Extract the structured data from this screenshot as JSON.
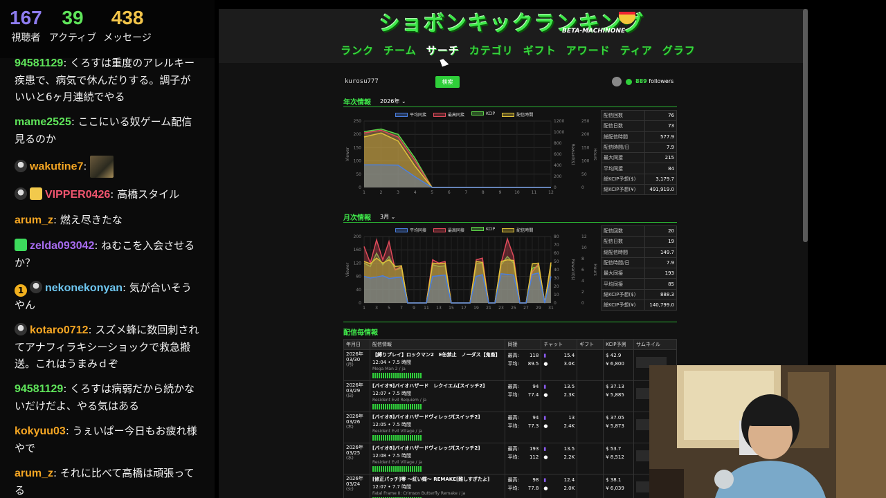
{
  "stats": [
    {
      "value": "167",
      "label": "視聴者",
      "color": "#8e7cf0"
    },
    {
      "value": "39",
      "label": "アクティブ",
      "color": "#5fe55a"
    },
    {
      "value": "438",
      "label": "メッセージ",
      "color": "#f3c54a"
    }
  ],
  "chat": [
    {
      "user": "94581129",
      "color": "#5fe55a",
      "text": "くろすは重度のアレルキー疾患で、病気で休んだりする。調子がいいと6ヶ月連続でやる",
      "badges": []
    },
    {
      "user": "mame2525",
      "color": "#5fe55a",
      "text": "ここにいる奴ゲーム配信見るのか",
      "badges": []
    },
    {
      "user": "wakutine7",
      "color": "#f5a623",
      "text": "",
      "badges": [
        "skull"
      ],
      "emote": true
    },
    {
      "user": "VIPPER0426",
      "color": "#f0556f",
      "text": "高橋スタイル",
      "badges": [
        "skull",
        "gift"
      ]
    },
    {
      "user": "arum_z",
      "color": "#f5a623",
      "text": "燃え尽きたな",
      "badges": []
    },
    {
      "user": "zelda093042",
      "color": "#a76cf0",
      "text": "ねむこを入会させるか？",
      "badges": [
        "gift2"
      ]
    },
    {
      "user": "nekonekonyan",
      "color": "#6ec6f0",
      "text": "気が合いそうやん",
      "badges": [
        "one",
        "skull"
      ]
    },
    {
      "user": "kotaro0712",
      "color": "#f5a623",
      "text": "スズメ蜂に数回刺されてアナフィラキシーショックで救急搬送。これはうまみｄぞ",
      "badges": [
        "skull"
      ]
    },
    {
      "user": "94581129",
      "color": "#5fe55a",
      "text": "くろすは病弱だから続かないだけだよ、やる気はある",
      "badges": []
    },
    {
      "user": "kokyuu03",
      "color": "#f5a623",
      "text": "うぇいぱー今日もお疲れ様やで",
      "badges": []
    },
    {
      "user": "arum_z",
      "color": "#f5a623",
      "text": "それに比べて高橋は頑張ってる",
      "badges": []
    }
  ],
  "site": {
    "logo": "ショボンキックランキング",
    "logo_sub": "BETA-MACHINONE",
    "nav": [
      "ランク",
      "チーム",
      "サーチ",
      "カテゴリ",
      "ギフト",
      "アワード",
      "ティア",
      "グラフ"
    ],
    "nav_active": 2,
    "search_value": "kurosu777",
    "search_button": "検索",
    "followers_count": "889",
    "followers_label": "followers",
    "yearly": {
      "title": "年次情報",
      "select": "2026年",
      "legend": [
        "平均同接",
        "最高同接",
        "KCIP",
        "配信時間"
      ],
      "y_left_label": "Viewer",
      "y_right1_label": "Reward($)",
      "y_right2_label": "Hours",
      "stats": [
        [
          "配信回数",
          "76"
        ],
        [
          "配信日数",
          "73"
        ],
        [
          "総配信時間",
          "577.9"
        ],
        [
          "配信時間/日",
          "7.9"
        ],
        [
          "最大同接",
          "215"
        ],
        [
          "平均同接",
          "84"
        ],
        [
          "総KCIP予想($)",
          "3,179.7"
        ],
        [
          "総KCIP予想(¥)",
          "491,919.0"
        ]
      ]
    },
    "monthly": {
      "title": "月次情報",
      "select": "3月",
      "legend": [
        "平均同接",
        "最高同接",
        "KCIP",
        "配信時間"
      ],
      "y_left_label": "Viewer",
      "y_right1_label": "Reward($)",
      "y_right2_label": "Hours",
      "stats": [
        [
          "配信回数",
          "20"
        ],
        [
          "配信日数",
          "19"
        ],
        [
          "総配信時間",
          "149.7"
        ],
        [
          "配信時間/日",
          "7.9"
        ],
        [
          "最大同接",
          "193"
        ],
        [
          "平均同接",
          "85"
        ],
        [
          "総KCIP予想($)",
          "888.3"
        ],
        [
          "総KCIP予想(¥)",
          "140,799.0"
        ]
      ]
    },
    "sessions_title": "配信毎情報",
    "sessions_headers": [
      "年月日",
      "配信情報",
      "同接",
      "チャット",
      "ギフト",
      "KCIP予測",
      "サムネイル"
    ],
    "sessions": [
      {
        "date": [
          "2026年",
          "03/30",
          "(月)"
        ],
        "title": "【縛りプレイ】ロックマン2　E缶禁止　ノーダス【鬼畜】",
        "time": "12:04 • 7.5 時間",
        "game": "Mega Man 2 / ja",
        "max": "118",
        "avg": "89.5",
        "chat1": "15.4",
        "chat2": "3.0K",
        "usd": "$ 42.9",
        "jpy": "¥ 6,800"
      },
      {
        "date": [
          "2026年",
          "03/29",
          "(日)"
        ],
        "title": "[バイオ9]バイオハザード　レクイエム[スイッチ2]",
        "time": "12:07 • 7.5 時間",
        "game": "Resident Evil Requiem / ja",
        "max": "94",
        "avg": "77.4",
        "chat1": "13.5",
        "chat2": "2.3K",
        "usd": "$ 37.13",
        "jpy": "¥ 5,885"
      },
      {
        "date": [
          "2026年",
          "03/26",
          "(木)"
        ],
        "title": "[バイオ8]バイオハザードヴィレッジ[スイッチ2]",
        "time": "12:05 • 7.5 時間",
        "game": "Resident Evil Village / ja",
        "max": "94",
        "avg": "77.3",
        "chat1": "13",
        "chat2": "2.4K",
        "usd": "$ 37.05",
        "jpy": "¥ 5,873"
      },
      {
        "date": [
          "2026年",
          "03/25",
          "(水)"
        ],
        "title": "[バイオ8]バイオハザードヴィレッジ[スイッチ2]",
        "time": "12:08 • 7.5 時間",
        "game": "Resident Evil Village / ja",
        "max": "193",
        "avg": "112",
        "chat1": "13.5",
        "chat2": "2.2K",
        "usd": "$ 53.7",
        "jpy": "¥ 8,512"
      },
      {
        "date": [
          "2026年",
          "03/24",
          "(火)"
        ],
        "title": "[修正パッチ]零 〜紅い蝶〜 REMAKE[難しすぎたよ]",
        "time": "12:07 • 7.7 時間",
        "game": "Fatal Frame II: Crimson Butterfly Remake / ja",
        "max": "98",
        "avg": "77.8",
        "chat1": "12.4",
        "chat2": "2.0K",
        "usd": "$ 38.1",
        "jpy": "¥ 6,039"
      }
    ],
    "sessions_labels": {
      "max": "最高:",
      "avg": "平均:"
    }
  },
  "chart_data": [
    {
      "type": "area",
      "title": "年次情報",
      "x": [
        1,
        2,
        3,
        4,
        5,
        6,
        7,
        8,
        9,
        10,
        11,
        12
      ],
      "xlabel": "",
      "ylabel": "Viewer",
      "ylim": [
        0,
        250
      ],
      "series": [
        {
          "name": "平均同接",
          "color": "#4a7fe0",
          "values": [
            85,
            85,
            84,
            40,
            0,
            0,
            0,
            0,
            0,
            0,
            0,
            0
          ]
        },
        {
          "name": "最高同接",
          "color": "#e04a5a",
          "values": [
            205,
            215,
            190,
            100,
            0,
            0,
            0,
            0,
            0,
            0,
            0,
            0
          ]
        },
        {
          "name": "KCIP",
          "color": "#5fd64a",
          "values": [
            210,
            220,
            200,
            110,
            0,
            0,
            0,
            0,
            0,
            0,
            0,
            0
          ]
        },
        {
          "name": "配信時間",
          "color": "#e0c23a",
          "values": [
            190,
            205,
            175,
            80,
            0,
            0,
            0,
            0,
            0,
            0,
            0,
            0
          ]
        }
      ]
    },
    {
      "type": "area",
      "title": "月次情報",
      "x": [
        1,
        2,
        3,
        4,
        5,
        6,
        7,
        8,
        9,
        10,
        11,
        12,
        13,
        14,
        15,
        16,
        17,
        18,
        19,
        20,
        21,
        22,
        23,
        24,
        25,
        26,
        27,
        28,
        29,
        30,
        31
      ],
      "xlabel": "",
      "ylabel": "Viewer",
      "ylim": [
        0,
        200
      ],
      "series": [
        {
          "name": "平均同接",
          "color": "#4a7fe0",
          "values": [
            80,
            75,
            78,
            82,
            74,
            76,
            78,
            0,
            0,
            0,
            0,
            80,
            82,
            84,
            0,
            0,
            0,
            0,
            80,
            85,
            0,
            0,
            88,
            86,
            84,
            0,
            0,
            86,
            90,
            0,
            80
          ]
        },
        {
          "name": "最高同接",
          "color": "#e04a5a",
          "values": [
            170,
            120,
            190,
            130,
            185,
            100,
            110,
            0,
            0,
            0,
            0,
            130,
            120,
            125,
            0,
            0,
            0,
            0,
            130,
            135,
            0,
            0,
            120,
            193,
            140,
            0,
            0,
            94,
            118,
            0,
            120
          ]
        },
        {
          "name": "KCIP",
          "color": "#5fd64a",
          "values": [
            120,
            110,
            150,
            115,
            140,
            100,
            105,
            0,
            0,
            0,
            0,
            115,
            110,
            112,
            0,
            0,
            0,
            0,
            118,
            120,
            0,
            0,
            115,
            140,
            120,
            0,
            0,
            105,
            110,
            0,
            115
          ]
        },
        {
          "name": "配信時間",
          "color": "#e0c23a",
          "values": [
            125,
            118,
            135,
            120,
            130,
            110,
            112,
            0,
            0,
            0,
            0,
            120,
            118,
            120,
            0,
            0,
            0,
            0,
            125,
            122,
            0,
            0,
            125,
            130,
            128,
            0,
            0,
            118,
            120,
            0,
            122
          ]
        }
      ]
    }
  ]
}
